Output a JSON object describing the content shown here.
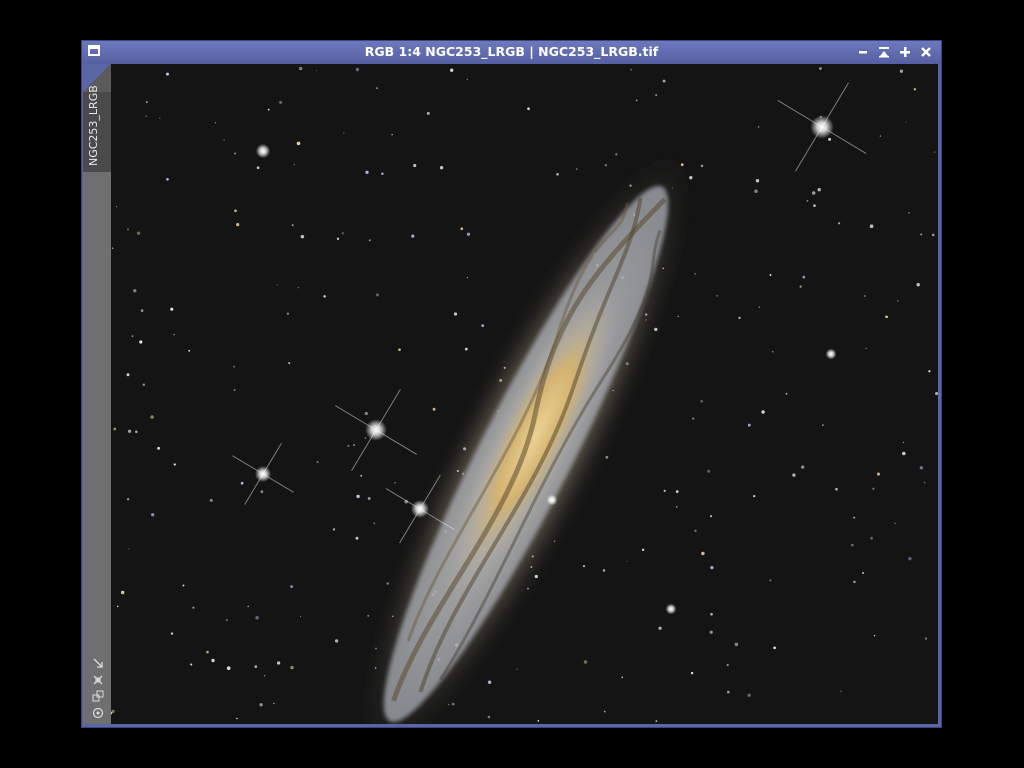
{
  "window": {
    "title": "RGB 1:4 NGC253_LRGB | NGC253_LRGB.tif",
    "tab_label": "NGC253_LRGB",
    "controls": {
      "minimize": "minimize-icon",
      "shade": "shade-icon",
      "maximize": "maximize-icon",
      "close": "close-icon"
    }
  },
  "sidebar": {
    "icons": [
      "resize-icon",
      "zoom-fit-icon",
      "clone-icon",
      "mask-icon"
    ]
  },
  "image": {
    "subject": "NGC253_LRGB",
    "background_color": "#131313",
    "galaxy_core_color": "#e8c878",
    "galaxy_arm_color": "#9aa4b8"
  },
  "colors": {
    "titlebar": "#5a66a6",
    "sidebar": "#6f6f6f"
  }
}
